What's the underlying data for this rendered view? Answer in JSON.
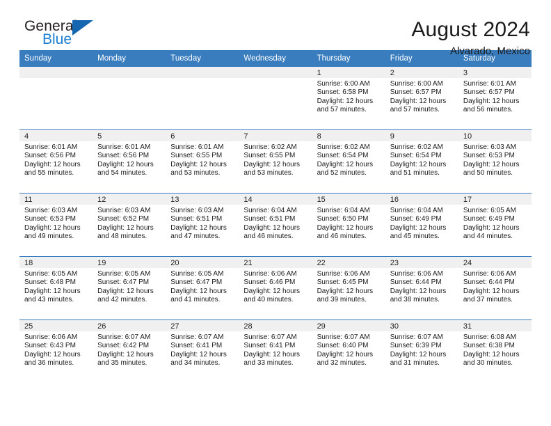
{
  "brand": {
    "line1": "General",
    "line2": "Blue",
    "accent_color": "#1c7fd3",
    "triangle_color": "#1566b0"
  },
  "header": {
    "month_title": "August 2024",
    "location": "Alvarado, Mexico"
  },
  "calendar": {
    "header_bg": "#3a7dbf",
    "weekdays": [
      "Sunday",
      "Monday",
      "Tuesday",
      "Wednesday",
      "Thursday",
      "Friday",
      "Saturday"
    ],
    "weeks": [
      [
        {
          "day": "",
          "lines": []
        },
        {
          "day": "",
          "lines": []
        },
        {
          "day": "",
          "lines": []
        },
        {
          "day": "",
          "lines": []
        },
        {
          "day": "1",
          "lines": [
            "Sunrise: 6:00 AM",
            "Sunset: 6:58 PM",
            "Daylight: 12 hours",
            "and 57 minutes."
          ]
        },
        {
          "day": "2",
          "lines": [
            "Sunrise: 6:00 AM",
            "Sunset: 6:57 PM",
            "Daylight: 12 hours",
            "and 57 minutes."
          ]
        },
        {
          "day": "3",
          "lines": [
            "Sunrise: 6:01 AM",
            "Sunset: 6:57 PM",
            "Daylight: 12 hours",
            "and 56 minutes."
          ]
        }
      ],
      [
        {
          "day": "4",
          "lines": [
            "Sunrise: 6:01 AM",
            "Sunset: 6:56 PM",
            "Daylight: 12 hours",
            "and 55 minutes."
          ]
        },
        {
          "day": "5",
          "lines": [
            "Sunrise: 6:01 AM",
            "Sunset: 6:56 PM",
            "Daylight: 12 hours",
            "and 54 minutes."
          ]
        },
        {
          "day": "6",
          "lines": [
            "Sunrise: 6:01 AM",
            "Sunset: 6:55 PM",
            "Daylight: 12 hours",
            "and 53 minutes."
          ]
        },
        {
          "day": "7",
          "lines": [
            "Sunrise: 6:02 AM",
            "Sunset: 6:55 PM",
            "Daylight: 12 hours",
            "and 53 minutes."
          ]
        },
        {
          "day": "8",
          "lines": [
            "Sunrise: 6:02 AM",
            "Sunset: 6:54 PM",
            "Daylight: 12 hours",
            "and 52 minutes."
          ]
        },
        {
          "day": "9",
          "lines": [
            "Sunrise: 6:02 AM",
            "Sunset: 6:54 PM",
            "Daylight: 12 hours",
            "and 51 minutes."
          ]
        },
        {
          "day": "10",
          "lines": [
            "Sunrise: 6:03 AM",
            "Sunset: 6:53 PM",
            "Daylight: 12 hours",
            "and 50 minutes."
          ]
        }
      ],
      [
        {
          "day": "11",
          "lines": [
            "Sunrise: 6:03 AM",
            "Sunset: 6:53 PM",
            "Daylight: 12 hours",
            "and 49 minutes."
          ]
        },
        {
          "day": "12",
          "lines": [
            "Sunrise: 6:03 AM",
            "Sunset: 6:52 PM",
            "Daylight: 12 hours",
            "and 48 minutes."
          ]
        },
        {
          "day": "13",
          "lines": [
            "Sunrise: 6:03 AM",
            "Sunset: 6:51 PM",
            "Daylight: 12 hours",
            "and 47 minutes."
          ]
        },
        {
          "day": "14",
          "lines": [
            "Sunrise: 6:04 AM",
            "Sunset: 6:51 PM",
            "Daylight: 12 hours",
            "and 46 minutes."
          ]
        },
        {
          "day": "15",
          "lines": [
            "Sunrise: 6:04 AM",
            "Sunset: 6:50 PM",
            "Daylight: 12 hours",
            "and 46 minutes."
          ]
        },
        {
          "day": "16",
          "lines": [
            "Sunrise: 6:04 AM",
            "Sunset: 6:49 PM",
            "Daylight: 12 hours",
            "and 45 minutes."
          ]
        },
        {
          "day": "17",
          "lines": [
            "Sunrise: 6:05 AM",
            "Sunset: 6:49 PM",
            "Daylight: 12 hours",
            "and 44 minutes."
          ]
        }
      ],
      [
        {
          "day": "18",
          "lines": [
            "Sunrise: 6:05 AM",
            "Sunset: 6:48 PM",
            "Daylight: 12 hours",
            "and 43 minutes."
          ]
        },
        {
          "day": "19",
          "lines": [
            "Sunrise: 6:05 AM",
            "Sunset: 6:47 PM",
            "Daylight: 12 hours",
            "and 42 minutes."
          ]
        },
        {
          "day": "20",
          "lines": [
            "Sunrise: 6:05 AM",
            "Sunset: 6:47 PM",
            "Daylight: 12 hours",
            "and 41 minutes."
          ]
        },
        {
          "day": "21",
          "lines": [
            "Sunrise: 6:06 AM",
            "Sunset: 6:46 PM",
            "Daylight: 12 hours",
            "and 40 minutes."
          ]
        },
        {
          "day": "22",
          "lines": [
            "Sunrise: 6:06 AM",
            "Sunset: 6:45 PM",
            "Daylight: 12 hours",
            "and 39 minutes."
          ]
        },
        {
          "day": "23",
          "lines": [
            "Sunrise: 6:06 AM",
            "Sunset: 6:44 PM",
            "Daylight: 12 hours",
            "and 38 minutes."
          ]
        },
        {
          "day": "24",
          "lines": [
            "Sunrise: 6:06 AM",
            "Sunset: 6:44 PM",
            "Daylight: 12 hours",
            "and 37 minutes."
          ]
        }
      ],
      [
        {
          "day": "25",
          "lines": [
            "Sunrise: 6:06 AM",
            "Sunset: 6:43 PM",
            "Daylight: 12 hours",
            "and 36 minutes."
          ]
        },
        {
          "day": "26",
          "lines": [
            "Sunrise: 6:07 AM",
            "Sunset: 6:42 PM",
            "Daylight: 12 hours",
            "and 35 minutes."
          ]
        },
        {
          "day": "27",
          "lines": [
            "Sunrise: 6:07 AM",
            "Sunset: 6:41 PM",
            "Daylight: 12 hours",
            "and 34 minutes."
          ]
        },
        {
          "day": "28",
          "lines": [
            "Sunrise: 6:07 AM",
            "Sunset: 6:41 PM",
            "Daylight: 12 hours",
            "and 33 minutes."
          ]
        },
        {
          "day": "29",
          "lines": [
            "Sunrise: 6:07 AM",
            "Sunset: 6:40 PM",
            "Daylight: 12 hours",
            "and 32 minutes."
          ]
        },
        {
          "day": "30",
          "lines": [
            "Sunrise: 6:07 AM",
            "Sunset: 6:39 PM",
            "Daylight: 12 hours",
            "and 31 minutes."
          ]
        },
        {
          "day": "31",
          "lines": [
            "Sunrise: 6:08 AM",
            "Sunset: 6:38 PM",
            "Daylight: 12 hours",
            "and 30 minutes."
          ]
        }
      ]
    ]
  }
}
